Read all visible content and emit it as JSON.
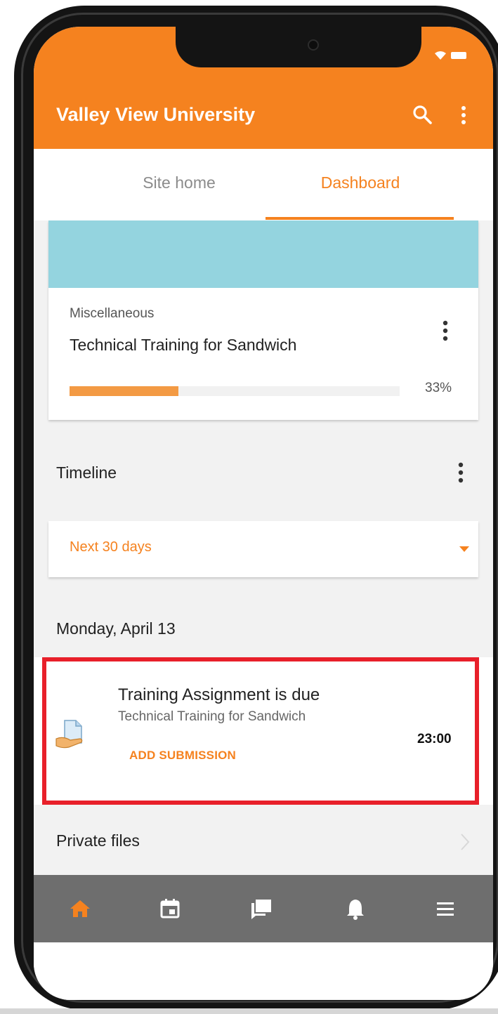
{
  "app": {
    "title": "Valley View University"
  },
  "appbar": {
    "search_icon": "search-icon",
    "more_icon": "more-vert-icon"
  },
  "tabs": [
    {
      "label": "Site home",
      "active": false
    },
    {
      "label": "Dashboard",
      "active": true
    }
  ],
  "course_card": {
    "category": "Miscellaneous",
    "name": "Technical Training for Sandwich",
    "progress": 0.33,
    "progress_label": "33%"
  },
  "timeline": {
    "title": "Timeline",
    "filter": "Next 30 days"
  },
  "events": {
    "date": "Monday, April 13",
    "items": [
      {
        "title": "Training Assignment is due",
        "course": "Technical Training for Sandwich",
        "action": "ADD SUBMISSION",
        "time": "23:00",
        "icon": "assignment-icon"
      }
    ]
  },
  "private_files": {
    "label": "Private files"
  },
  "bottom_nav": [
    {
      "icon": "home-icon",
      "active": true
    },
    {
      "icon": "calendar-icon",
      "active": false
    },
    {
      "icon": "messages-icon",
      "active": false
    },
    {
      "icon": "notifications-icon",
      "active": false
    },
    {
      "icon": "menu-icon",
      "active": false
    }
  ],
  "colors": {
    "brand": "#f5821f",
    "course_image": "#94d4df",
    "highlight": "#e8202a",
    "bottom_nav": "#6e6e6e"
  }
}
